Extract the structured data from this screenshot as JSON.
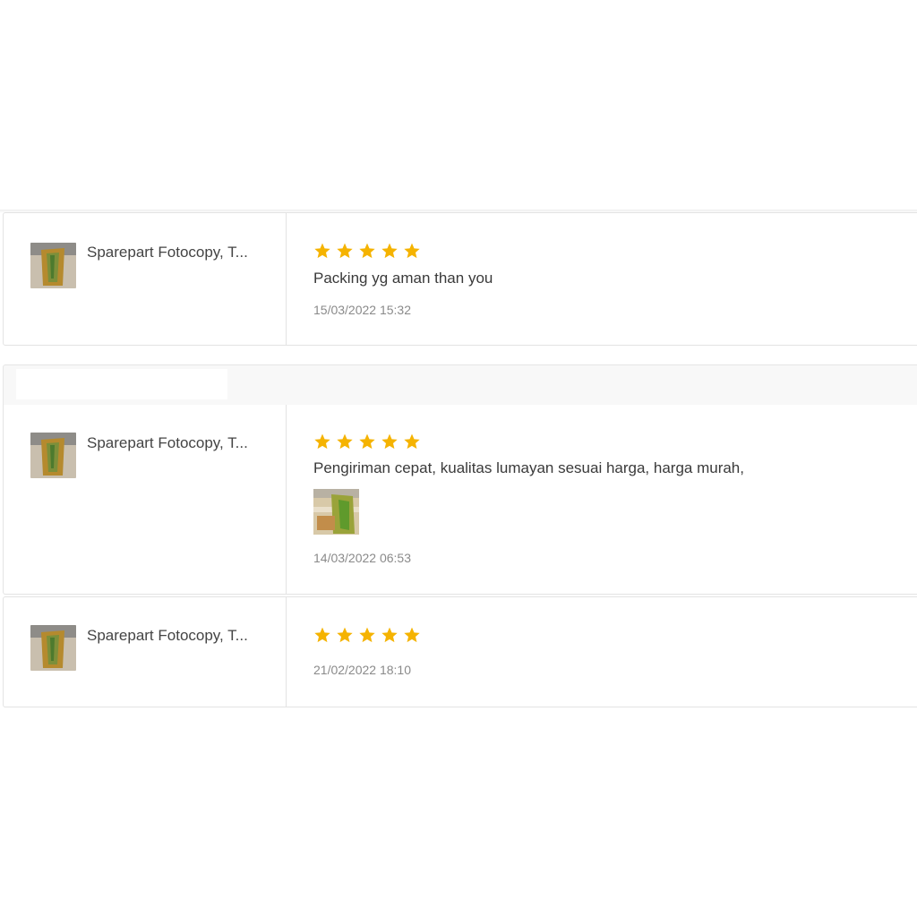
{
  "reviews": [
    {
      "product_name": "Sparepart Fotocopy, T...",
      "rating": 5,
      "comment": "Packing yg aman than you",
      "date": "15/03/2022 15:32",
      "has_photo": false
    },
    {
      "product_name": "Sparepart Fotocopy, T...",
      "rating": 5,
      "comment": "Pengiriman cepat, kualitas lumayan sesuai harga, harga murah,",
      "date": "14/03/2022 06:53",
      "has_photo": true
    },
    {
      "product_name": "Sparepart Fotocopy, T...",
      "rating": 5,
      "comment": "",
      "date": "21/02/2022 18:10",
      "has_photo": false
    }
  ],
  "colors": {
    "star": "#f5b301",
    "border": "#e3e3e3",
    "date_text": "#8a8a8a"
  },
  "icons": {
    "star": "star-icon",
    "product": "product-thumbnail-image",
    "photo": "review-photo-image"
  }
}
